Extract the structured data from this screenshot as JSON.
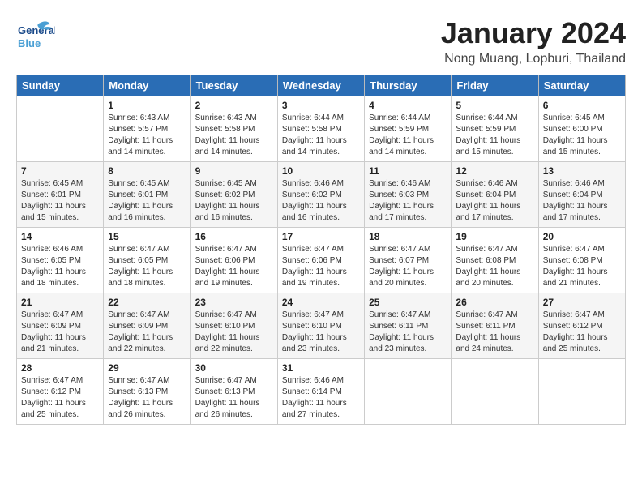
{
  "header": {
    "logo_general": "General",
    "logo_blue": "Blue",
    "month": "January 2024",
    "location": "Nong Muang, Lopburi, Thailand"
  },
  "weekdays": [
    "Sunday",
    "Monday",
    "Tuesday",
    "Wednesday",
    "Thursday",
    "Friday",
    "Saturday"
  ],
  "weeks": [
    [
      {
        "day": "",
        "info": ""
      },
      {
        "day": "1",
        "info": "Sunrise: 6:43 AM\nSunset: 5:57 PM\nDaylight: 11 hours\nand 14 minutes."
      },
      {
        "day": "2",
        "info": "Sunrise: 6:43 AM\nSunset: 5:58 PM\nDaylight: 11 hours\nand 14 minutes."
      },
      {
        "day": "3",
        "info": "Sunrise: 6:44 AM\nSunset: 5:58 PM\nDaylight: 11 hours\nand 14 minutes."
      },
      {
        "day": "4",
        "info": "Sunrise: 6:44 AM\nSunset: 5:59 PM\nDaylight: 11 hours\nand 14 minutes."
      },
      {
        "day": "5",
        "info": "Sunrise: 6:44 AM\nSunset: 5:59 PM\nDaylight: 11 hours\nand 15 minutes."
      },
      {
        "day": "6",
        "info": "Sunrise: 6:45 AM\nSunset: 6:00 PM\nDaylight: 11 hours\nand 15 minutes."
      }
    ],
    [
      {
        "day": "7",
        "info": "Sunrise: 6:45 AM\nSunset: 6:01 PM\nDaylight: 11 hours\nand 15 minutes."
      },
      {
        "day": "8",
        "info": "Sunrise: 6:45 AM\nSunset: 6:01 PM\nDaylight: 11 hours\nand 16 minutes."
      },
      {
        "day": "9",
        "info": "Sunrise: 6:45 AM\nSunset: 6:02 PM\nDaylight: 11 hours\nand 16 minutes."
      },
      {
        "day": "10",
        "info": "Sunrise: 6:46 AM\nSunset: 6:02 PM\nDaylight: 11 hours\nand 16 minutes."
      },
      {
        "day": "11",
        "info": "Sunrise: 6:46 AM\nSunset: 6:03 PM\nDaylight: 11 hours\nand 17 minutes."
      },
      {
        "day": "12",
        "info": "Sunrise: 6:46 AM\nSunset: 6:04 PM\nDaylight: 11 hours\nand 17 minutes."
      },
      {
        "day": "13",
        "info": "Sunrise: 6:46 AM\nSunset: 6:04 PM\nDaylight: 11 hours\nand 17 minutes."
      }
    ],
    [
      {
        "day": "14",
        "info": "Sunrise: 6:46 AM\nSunset: 6:05 PM\nDaylight: 11 hours\nand 18 minutes."
      },
      {
        "day": "15",
        "info": "Sunrise: 6:47 AM\nSunset: 6:05 PM\nDaylight: 11 hours\nand 18 minutes."
      },
      {
        "day": "16",
        "info": "Sunrise: 6:47 AM\nSunset: 6:06 PM\nDaylight: 11 hours\nand 19 minutes."
      },
      {
        "day": "17",
        "info": "Sunrise: 6:47 AM\nSunset: 6:06 PM\nDaylight: 11 hours\nand 19 minutes."
      },
      {
        "day": "18",
        "info": "Sunrise: 6:47 AM\nSunset: 6:07 PM\nDaylight: 11 hours\nand 20 minutes."
      },
      {
        "day": "19",
        "info": "Sunrise: 6:47 AM\nSunset: 6:08 PM\nDaylight: 11 hours\nand 20 minutes."
      },
      {
        "day": "20",
        "info": "Sunrise: 6:47 AM\nSunset: 6:08 PM\nDaylight: 11 hours\nand 21 minutes."
      }
    ],
    [
      {
        "day": "21",
        "info": "Sunrise: 6:47 AM\nSunset: 6:09 PM\nDaylight: 11 hours\nand 21 minutes."
      },
      {
        "day": "22",
        "info": "Sunrise: 6:47 AM\nSunset: 6:09 PM\nDaylight: 11 hours\nand 22 minutes."
      },
      {
        "day": "23",
        "info": "Sunrise: 6:47 AM\nSunset: 6:10 PM\nDaylight: 11 hours\nand 22 minutes."
      },
      {
        "day": "24",
        "info": "Sunrise: 6:47 AM\nSunset: 6:10 PM\nDaylight: 11 hours\nand 23 minutes."
      },
      {
        "day": "25",
        "info": "Sunrise: 6:47 AM\nSunset: 6:11 PM\nDaylight: 11 hours\nand 23 minutes."
      },
      {
        "day": "26",
        "info": "Sunrise: 6:47 AM\nSunset: 6:11 PM\nDaylight: 11 hours\nand 24 minutes."
      },
      {
        "day": "27",
        "info": "Sunrise: 6:47 AM\nSunset: 6:12 PM\nDaylight: 11 hours\nand 25 minutes."
      }
    ],
    [
      {
        "day": "28",
        "info": "Sunrise: 6:47 AM\nSunset: 6:12 PM\nDaylight: 11 hours\nand 25 minutes."
      },
      {
        "day": "29",
        "info": "Sunrise: 6:47 AM\nSunset: 6:13 PM\nDaylight: 11 hours\nand 26 minutes."
      },
      {
        "day": "30",
        "info": "Sunrise: 6:47 AM\nSunset: 6:13 PM\nDaylight: 11 hours\nand 26 minutes."
      },
      {
        "day": "31",
        "info": "Sunrise: 6:46 AM\nSunset: 6:14 PM\nDaylight: 11 hours\nand 27 minutes."
      },
      {
        "day": "",
        "info": ""
      },
      {
        "day": "",
        "info": ""
      },
      {
        "day": "",
        "info": ""
      }
    ]
  ]
}
